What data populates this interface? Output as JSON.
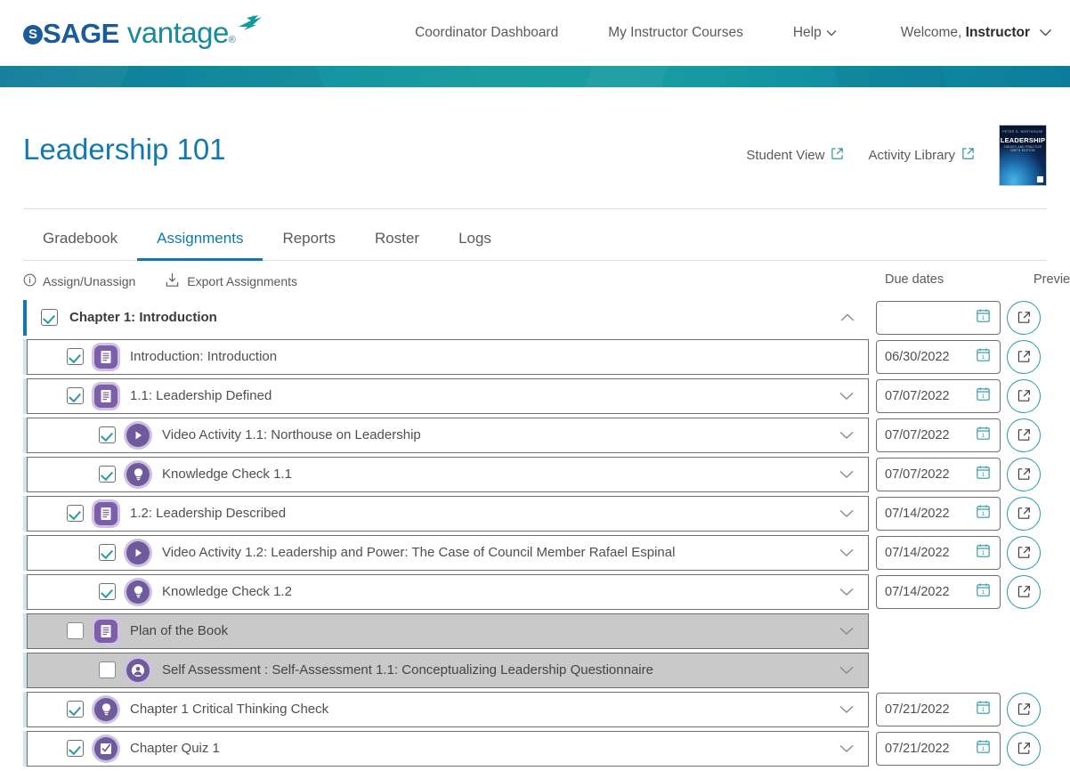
{
  "brand": {
    "sage": "SAGE",
    "vantage": "vantage",
    "reg": "®",
    "accent_teal": "#1a8a9a",
    "accent_blue": "#1b5a9b",
    "link_blue": "#1279ae"
  },
  "topnav": {
    "items": [
      {
        "label": "Coordinator Dashboard",
        "has_chevron": false
      },
      {
        "label": "My Instructor Courses",
        "has_chevron": false
      },
      {
        "label": "Help",
        "has_chevron": true
      }
    ],
    "welcome_prefix": "Welcome,",
    "welcome_user": "Instructor"
  },
  "header": {
    "course_title": "Leadership 101",
    "student_view": "Student View",
    "activity_library": "Activity Library",
    "book_cover": {
      "author": "PETER G. NORTHOUSE",
      "title": "LEADERSHIP",
      "subtitle": "THEORY AND PRACTICE  NINTH EDITION"
    }
  },
  "tabs": [
    {
      "label": "Gradebook",
      "active": false
    },
    {
      "label": "Assignments",
      "active": true
    },
    {
      "label": "Reports",
      "active": false
    },
    {
      "label": "Roster",
      "active": false
    },
    {
      "label": "Logs",
      "active": false
    }
  ],
  "toolbar": {
    "assign_unassign": "Assign/Unassign",
    "export_assignments": "Export Assignments",
    "col_due_dates": "Due dates",
    "col_preview": "Preview"
  },
  "assignments": [
    {
      "label": "Chapter 1: Introduction",
      "type": "chapter",
      "icon": null,
      "indent": 0,
      "checked": true,
      "disabled": false,
      "chevron": "up",
      "due_date": "",
      "has_date": true,
      "has_preview": true
    },
    {
      "label": "Introduction: Introduction",
      "type": "reading",
      "icon": "document-icon",
      "indent": 1,
      "checked": true,
      "disabled": false,
      "chevron": "none",
      "due_date": "06/30/2022",
      "has_date": true,
      "has_preview": true
    },
    {
      "label": "1.1: Leadership Defined",
      "type": "reading",
      "icon": "document-icon",
      "indent": 1,
      "checked": true,
      "disabled": false,
      "chevron": "down",
      "due_date": "07/07/2022",
      "has_date": true,
      "has_preview": true
    },
    {
      "label": "Video Activity 1.1: Northouse on Leadership",
      "type": "video",
      "icon": "play-icon",
      "indent": 2,
      "checked": true,
      "disabled": false,
      "chevron": "down",
      "due_date": "07/07/2022",
      "has_date": true,
      "has_preview": true
    },
    {
      "label": "Knowledge Check 1.1",
      "type": "knowledge-check",
      "icon": "lightbulb-icon",
      "indent": 2,
      "checked": true,
      "disabled": false,
      "chevron": "down",
      "due_date": "07/07/2022",
      "has_date": true,
      "has_preview": true
    },
    {
      "label": "1.2: Leadership Described",
      "type": "reading",
      "icon": "document-icon",
      "indent": 1,
      "checked": true,
      "disabled": false,
      "chevron": "down",
      "due_date": "07/14/2022",
      "has_date": true,
      "has_preview": true
    },
    {
      "label": "Video Activity 1.2: Leadership and Power: The Case of Council Member Rafael Espinal",
      "type": "video",
      "icon": "play-icon",
      "indent": 2,
      "checked": true,
      "disabled": false,
      "chevron": "down",
      "due_date": "07/14/2022",
      "has_date": true,
      "has_preview": true
    },
    {
      "label": "Knowledge Check 1.2",
      "type": "knowledge-check",
      "icon": "lightbulb-icon",
      "indent": 2,
      "checked": true,
      "disabled": false,
      "chevron": "down",
      "due_date": "07/14/2022",
      "has_date": true,
      "has_preview": true
    },
    {
      "label": "Plan of the Book",
      "type": "reading",
      "icon": "document-icon",
      "indent": 1,
      "checked": false,
      "disabled": true,
      "chevron": "down",
      "due_date": "",
      "has_date": false,
      "has_preview": false
    },
    {
      "label": "Self Assessment : Self-Assessment 1.1: Conceptualizing Leadership Questionnaire",
      "type": "self-assessment",
      "icon": "person-icon",
      "indent": 2,
      "checked": false,
      "disabled": true,
      "chevron": "down",
      "due_date": "",
      "has_date": false,
      "has_preview": false
    },
    {
      "label": "Chapter 1 Critical Thinking Check",
      "type": "knowledge-check",
      "icon": "lightbulb-icon",
      "indent": 1,
      "checked": true,
      "disabled": false,
      "chevron": "down",
      "due_date": "07/21/2022",
      "has_date": true,
      "has_preview": true
    },
    {
      "label": "Chapter Quiz 1",
      "type": "quiz",
      "icon": "checkbox-circle-icon",
      "indent": 1,
      "checked": true,
      "disabled": false,
      "chevron": "down",
      "due_date": "07/21/2022",
      "has_date": true,
      "has_preview": true
    }
  ]
}
